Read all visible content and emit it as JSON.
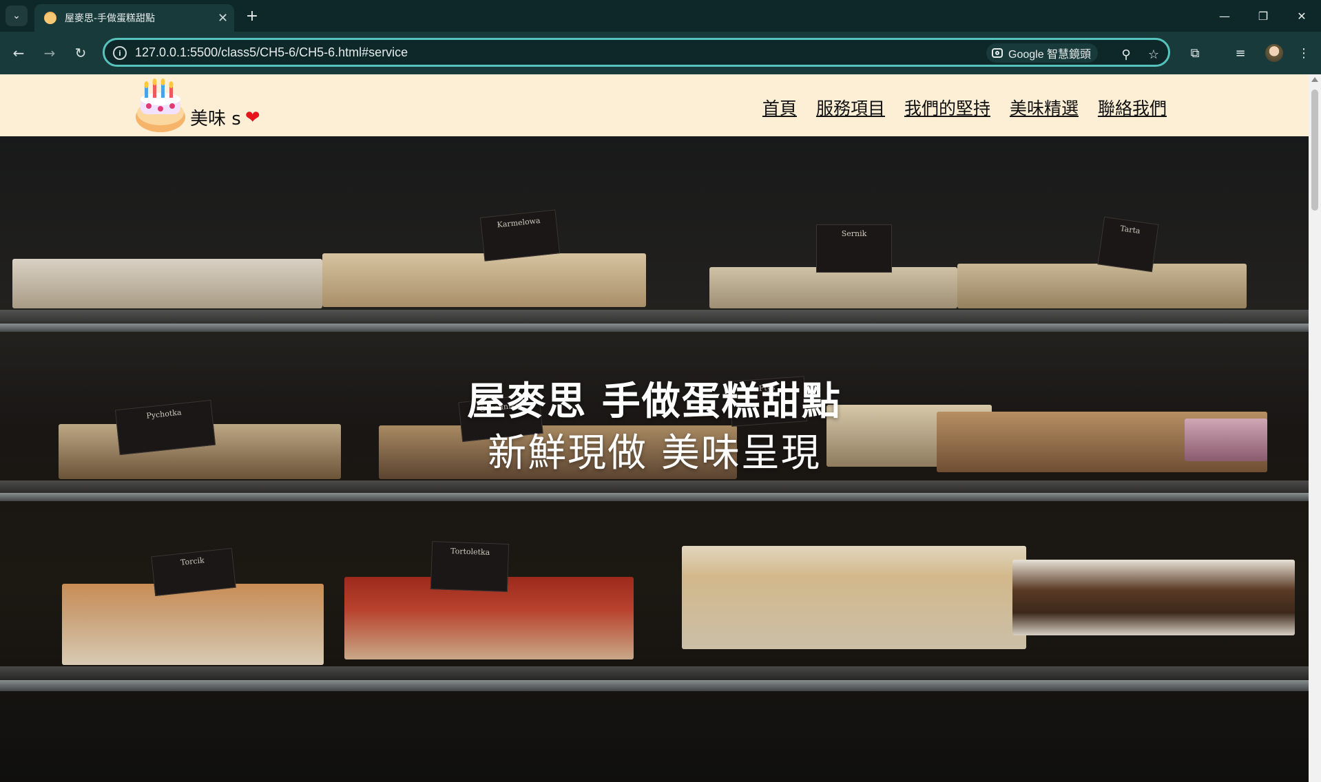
{
  "browser": {
    "tab_title": "屋麥思-手做蛋糕甜點",
    "url": "127.0.0.1:5500/class5/CH5-6/CH5-6.html#service",
    "lens_label": "Google 智慧鏡頭",
    "icons": [
      "tab-search-icon",
      "close-icon",
      "new-tab-icon",
      "minimize-icon",
      "restore-icon",
      "window-close-icon",
      "back-icon",
      "forward-icon",
      "reload-icon",
      "site-info-icon",
      "lens-icon",
      "zoom-icon",
      "bookmark-star-icon",
      "extensions-icon",
      "media-icon",
      "profile-avatar",
      "more-menu-icon"
    ]
  },
  "site": {
    "brand": "美味 s",
    "heart": "❤",
    "nav": [
      "首頁",
      "服務項目",
      "我們的堅持",
      "美味精選",
      "聯絡我們"
    ]
  },
  "hero": {
    "line1": "屋麥思 手做蛋糕甜點",
    "line2": "新鮮現做 美味呈現"
  },
  "colors": {
    "tab_bg": "#0e2728",
    "toolbar_bg": "#193a3b",
    "omnibox_border": "#57c3bd",
    "header_bg": "#fcefd6",
    "heart": "#e6141b"
  }
}
